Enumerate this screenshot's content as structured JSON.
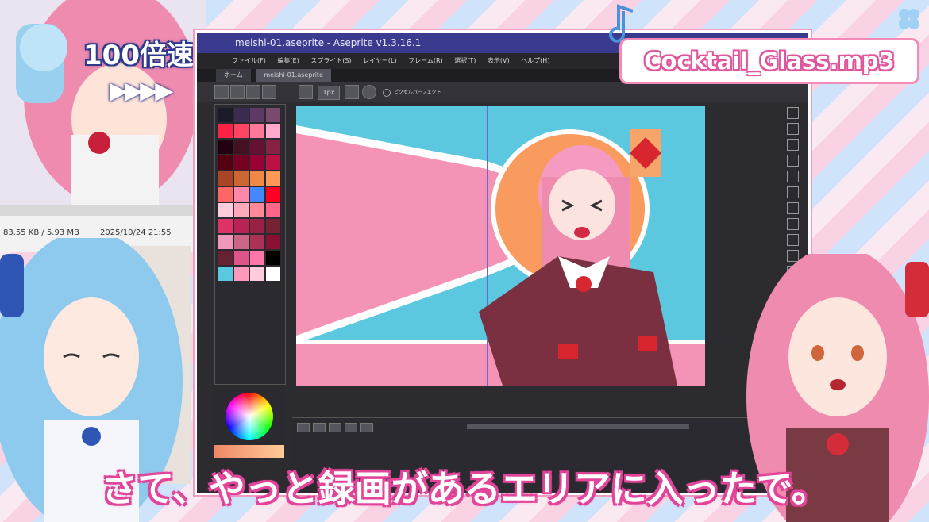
{
  "window": {
    "title": "meishi-01.aseprite - Aseprite v1.3.16.1",
    "menus": [
      "ファイル(F)",
      "編集(E)",
      "スプライト(S)",
      "レイヤー(L)",
      "フレーム(R)",
      "選択(T)",
      "表示(V)",
      "ヘルプ(H)"
    ],
    "tabs": [
      "ホーム",
      "meishi-01.aseprite"
    ],
    "brush_size": "1px",
    "pixel_perfect": "ピクセルパーフェクト"
  },
  "overlay": {
    "speed": "100倍速",
    "arrows": "▶▶▶▶",
    "music": "Cocktail_Glass.mp3",
    "subtitle": "さて、やっと録画があるエリアに入ったで。"
  },
  "explorer": {
    "size": "83.55 KB / 5.93 MB",
    "date": "2025/10/24 21:55"
  },
  "colors": {
    "frame_border": "#f29cc1",
    "accent_pink": "#e2449a",
    "accent_blue": "#2d3a8c",
    "canvas_bg": "#5cc8e0"
  },
  "palette": [
    "#1b1b2a",
    "#3b2d52",
    "#5d3a66",
    "#7a4a6e",
    "#ff2244",
    "#ff4466",
    "#ff7799",
    "#ffaacc",
    "#220011",
    "#441122",
    "#661133",
    "#882244",
    "#550011",
    "#770022",
    "#990033",
    "#bb1144",
    "#aa4422",
    "#cc6633",
    "#ee8844",
    "#ff9955",
    "#ff6666",
    "#ff88aa",
    "#4488ff",
    "#ff0022",
    "#ffccdd",
    "#ffaabb",
    "#ff8899",
    "#ff6688",
    "#dd3366",
    "#bb2255",
    "#992244",
    "#772233",
    "#ee99bb",
    "#cc6688",
    "#aa3355",
    "#881133",
    "#662233",
    "#dd5588",
    "#ff77aa",
    "#000000",
    "#5cc8e0",
    "#ff99bb",
    "#ffccdd",
    "#ffffff"
  ]
}
